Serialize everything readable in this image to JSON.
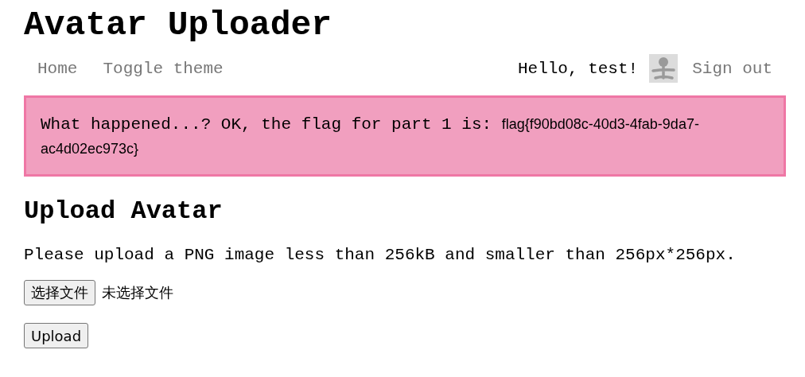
{
  "title": "Avatar Uploader",
  "nav": {
    "links": [
      {
        "label": "Home"
      },
      {
        "label": "Toggle theme"
      }
    ],
    "greeting": "Hello, test!",
    "sign_out": "Sign out"
  },
  "alert": {
    "message": "What happened...? OK, the flag for part 1 is: ",
    "flag": "flag{f90bd08c-40d3-4fab-9da7-ac4d02ec973c}"
  },
  "section": {
    "heading": "Upload Avatar",
    "instructions": "Please upload a PNG image less than 256kB and smaller than 256px*256px.",
    "file_button": "选择文件",
    "file_status": "未选择文件",
    "submit": "Upload"
  }
}
